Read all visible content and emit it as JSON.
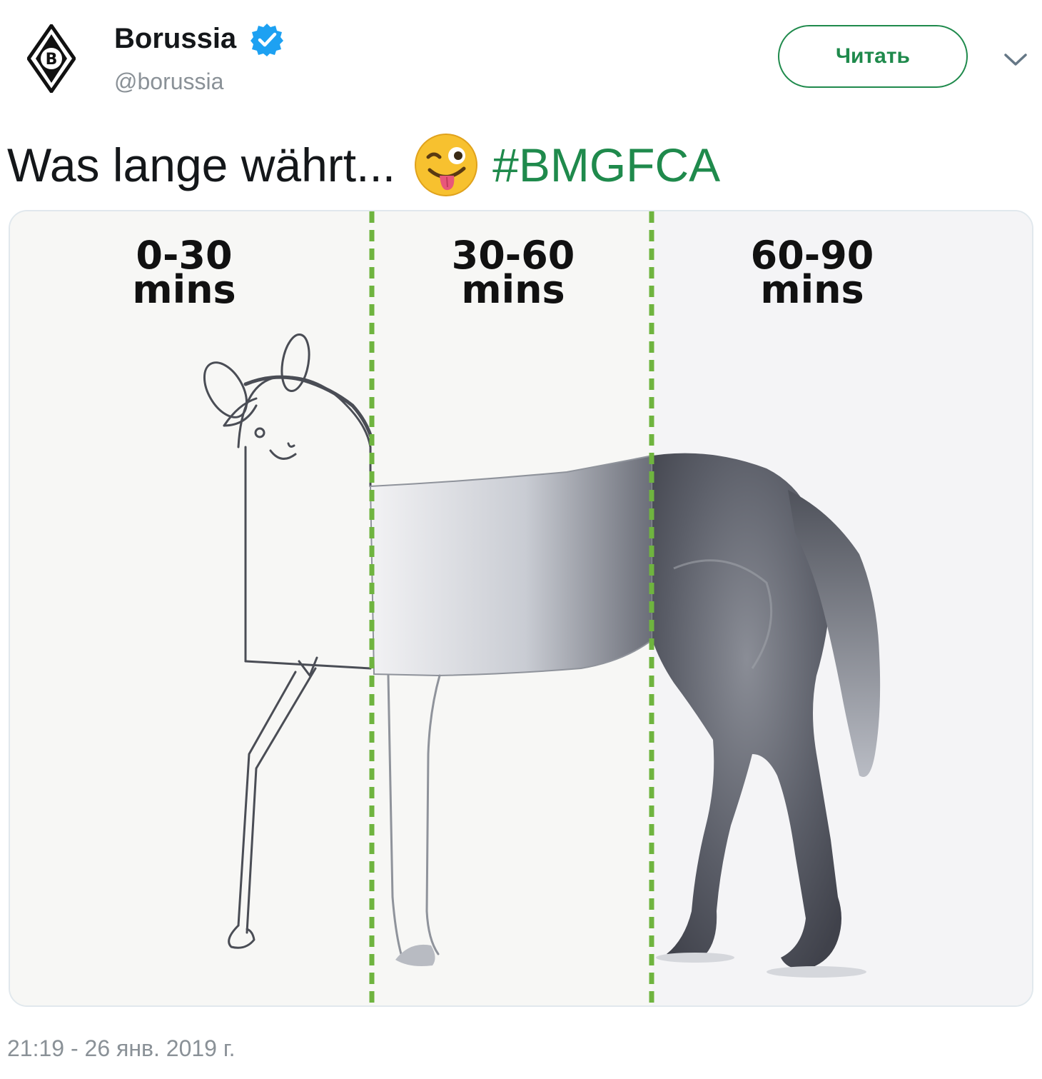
{
  "author": {
    "display_name": "Borussia",
    "handle": "@borussia",
    "verified": true,
    "avatar_icon": "club-crest-icon"
  },
  "actions": {
    "follow_label": "Читать",
    "more_icon": "chevron-down-icon"
  },
  "tweet": {
    "text": "Was lange währt...",
    "emoji": "winking-face-with-tongue",
    "hashtag": "#BMGFCA",
    "timestamp": "21:19 - 26 янв. 2019 г."
  },
  "media": {
    "segments": [
      {
        "top": "0-30",
        "bottom": "mins"
      },
      {
        "top": "30-60",
        "bottom": "mins"
      },
      {
        "top": "60-90",
        "bottom": "mins"
      }
    ],
    "divider_color": "#6fb43f"
  },
  "colors": {
    "accent_green": "#1f8a4c",
    "verified_blue": "#1da1f2",
    "muted_text": "#8a9197"
  }
}
